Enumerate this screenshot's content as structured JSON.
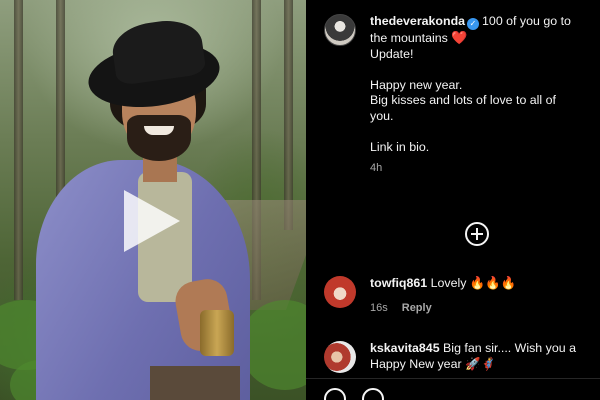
{
  "media": {
    "play_icon": "play-icon"
  },
  "post": {
    "author": "thedeverakonda",
    "verified_icon": "verified-badge-icon",
    "caption_lines": [
      "100 of you go to",
      "the mountains",
      "Update!",
      "Happy new year.",
      "Big kisses and lots of love to all of",
      "you.",
      "Link in bio."
    ],
    "caption_emoji": "❤️",
    "timestamp": "4h",
    "load_more_icon": "plus-circle-icon"
  },
  "comments": [
    {
      "username": "towfiq861",
      "text": "Lovely",
      "emoji": "🔥🔥🔥",
      "time": "16s",
      "reply_label": "Reply"
    },
    {
      "username": "kskavita845",
      "text": "Big fan sir.... Wish you a",
      "text2": "Happy New year",
      "emoji": "🚀🦸"
    }
  ],
  "colors": {
    "background": "#000000",
    "text": "#f5f5f5",
    "muted": "#a8a8a8",
    "verified": "#3897f0",
    "heart": "#e0245e"
  }
}
